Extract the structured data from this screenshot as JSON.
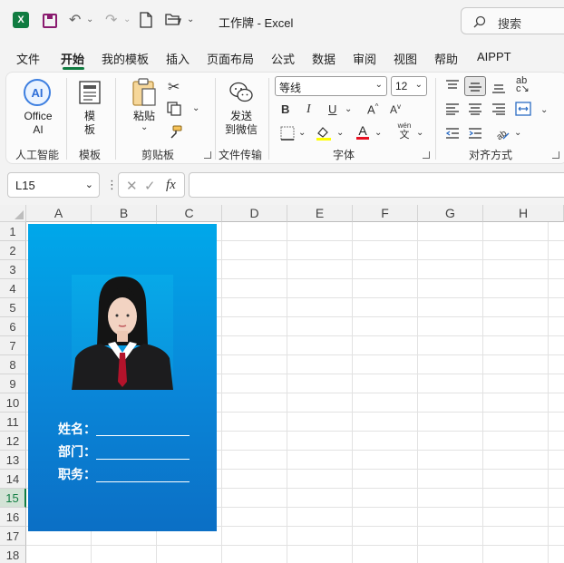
{
  "window": {
    "title": "工作牌  -  Excel",
    "search_placeholder": "搜索"
  },
  "menu": [
    "文件",
    "开始",
    "我的模板",
    "插入",
    "页面布局",
    "公式",
    "数据",
    "审阅",
    "视图",
    "帮助",
    "AIPPT"
  ],
  "menu_active": "开始",
  "ribbon": {
    "ai": {
      "label_line1": "Office",
      "label_line2": "AI",
      "group": "人工智能"
    },
    "template": {
      "label_line1": "模",
      "label_line2": "板",
      "group": "模板"
    },
    "clipboard": {
      "paste": "粘贴",
      "group": "剪贴板"
    },
    "file_transfer": {
      "label_line1": "发送",
      "label_line2": "到微信",
      "group": "文件传输"
    },
    "font": {
      "name": "等线",
      "size": "12",
      "group": "字体",
      "bold": "B",
      "italic": "I",
      "underline": "U",
      "grow": "A",
      "shrink": "A",
      "phonetic_top": "wén",
      "phonetic_bottom": "文",
      "fill_color": "#ffff00",
      "font_color": "#e81123"
    },
    "alignment": {
      "group": "对齐方式"
    }
  },
  "formula_bar": {
    "cell_ref": "L15",
    "fx": "fx",
    "content": ""
  },
  "sheet": {
    "columns": [
      "A",
      "B",
      "C",
      "D",
      "E",
      "F",
      "G",
      "H"
    ],
    "rows": [
      "1",
      "2",
      "3",
      "4",
      "5",
      "6",
      "7",
      "8",
      "9",
      "10",
      "11",
      "12",
      "13",
      "14",
      "15",
      "16",
      "17",
      "18"
    ],
    "selected_row": "15"
  },
  "badge": {
    "fields": [
      "姓名：",
      "部门：",
      "职务："
    ],
    "colors": {
      "top": "#00a8ea",
      "bottom": "#0b6fc5"
    }
  }
}
